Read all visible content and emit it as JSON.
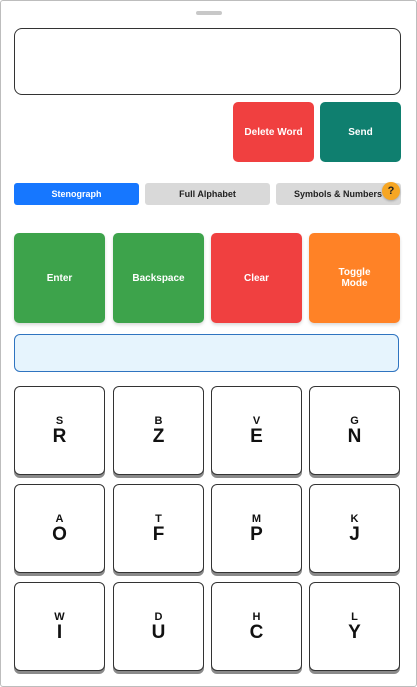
{
  "actions_top": {
    "delete_word": "Delete Word",
    "send": "Send"
  },
  "tabs": [
    {
      "label": "Stenograph",
      "active": true
    },
    {
      "label": "Full Alphabet",
      "active": false
    },
    {
      "label": "Symbols & Numbers",
      "active": false
    }
  ],
  "help_label": "?",
  "controls": {
    "enter": "Enter",
    "backspace": "Backspace",
    "clear": "Clear",
    "toggle_line1": "Toggle",
    "toggle_line2": "Mode"
  },
  "keys": [
    {
      "small": "S",
      "big": "R"
    },
    {
      "small": "B",
      "big": "Z"
    },
    {
      "small": "V",
      "big": "E"
    },
    {
      "small": "G",
      "big": "N"
    },
    {
      "small": "A",
      "big": "O"
    },
    {
      "small": "T",
      "big": "F"
    },
    {
      "small": "M",
      "big": "P"
    },
    {
      "small": "K",
      "big": "J"
    },
    {
      "small": "W",
      "big": "I"
    },
    {
      "small": "D",
      "big": "U"
    },
    {
      "small": "H",
      "big": "C"
    },
    {
      "small": "L",
      "big": "Y"
    }
  ],
  "colors": {
    "active_tab": "#1677ff",
    "send": "#0f7f6f",
    "delete": "#f04040",
    "enter": "#3da34b",
    "toggle": "#ff8226",
    "help": "#f6a623"
  }
}
